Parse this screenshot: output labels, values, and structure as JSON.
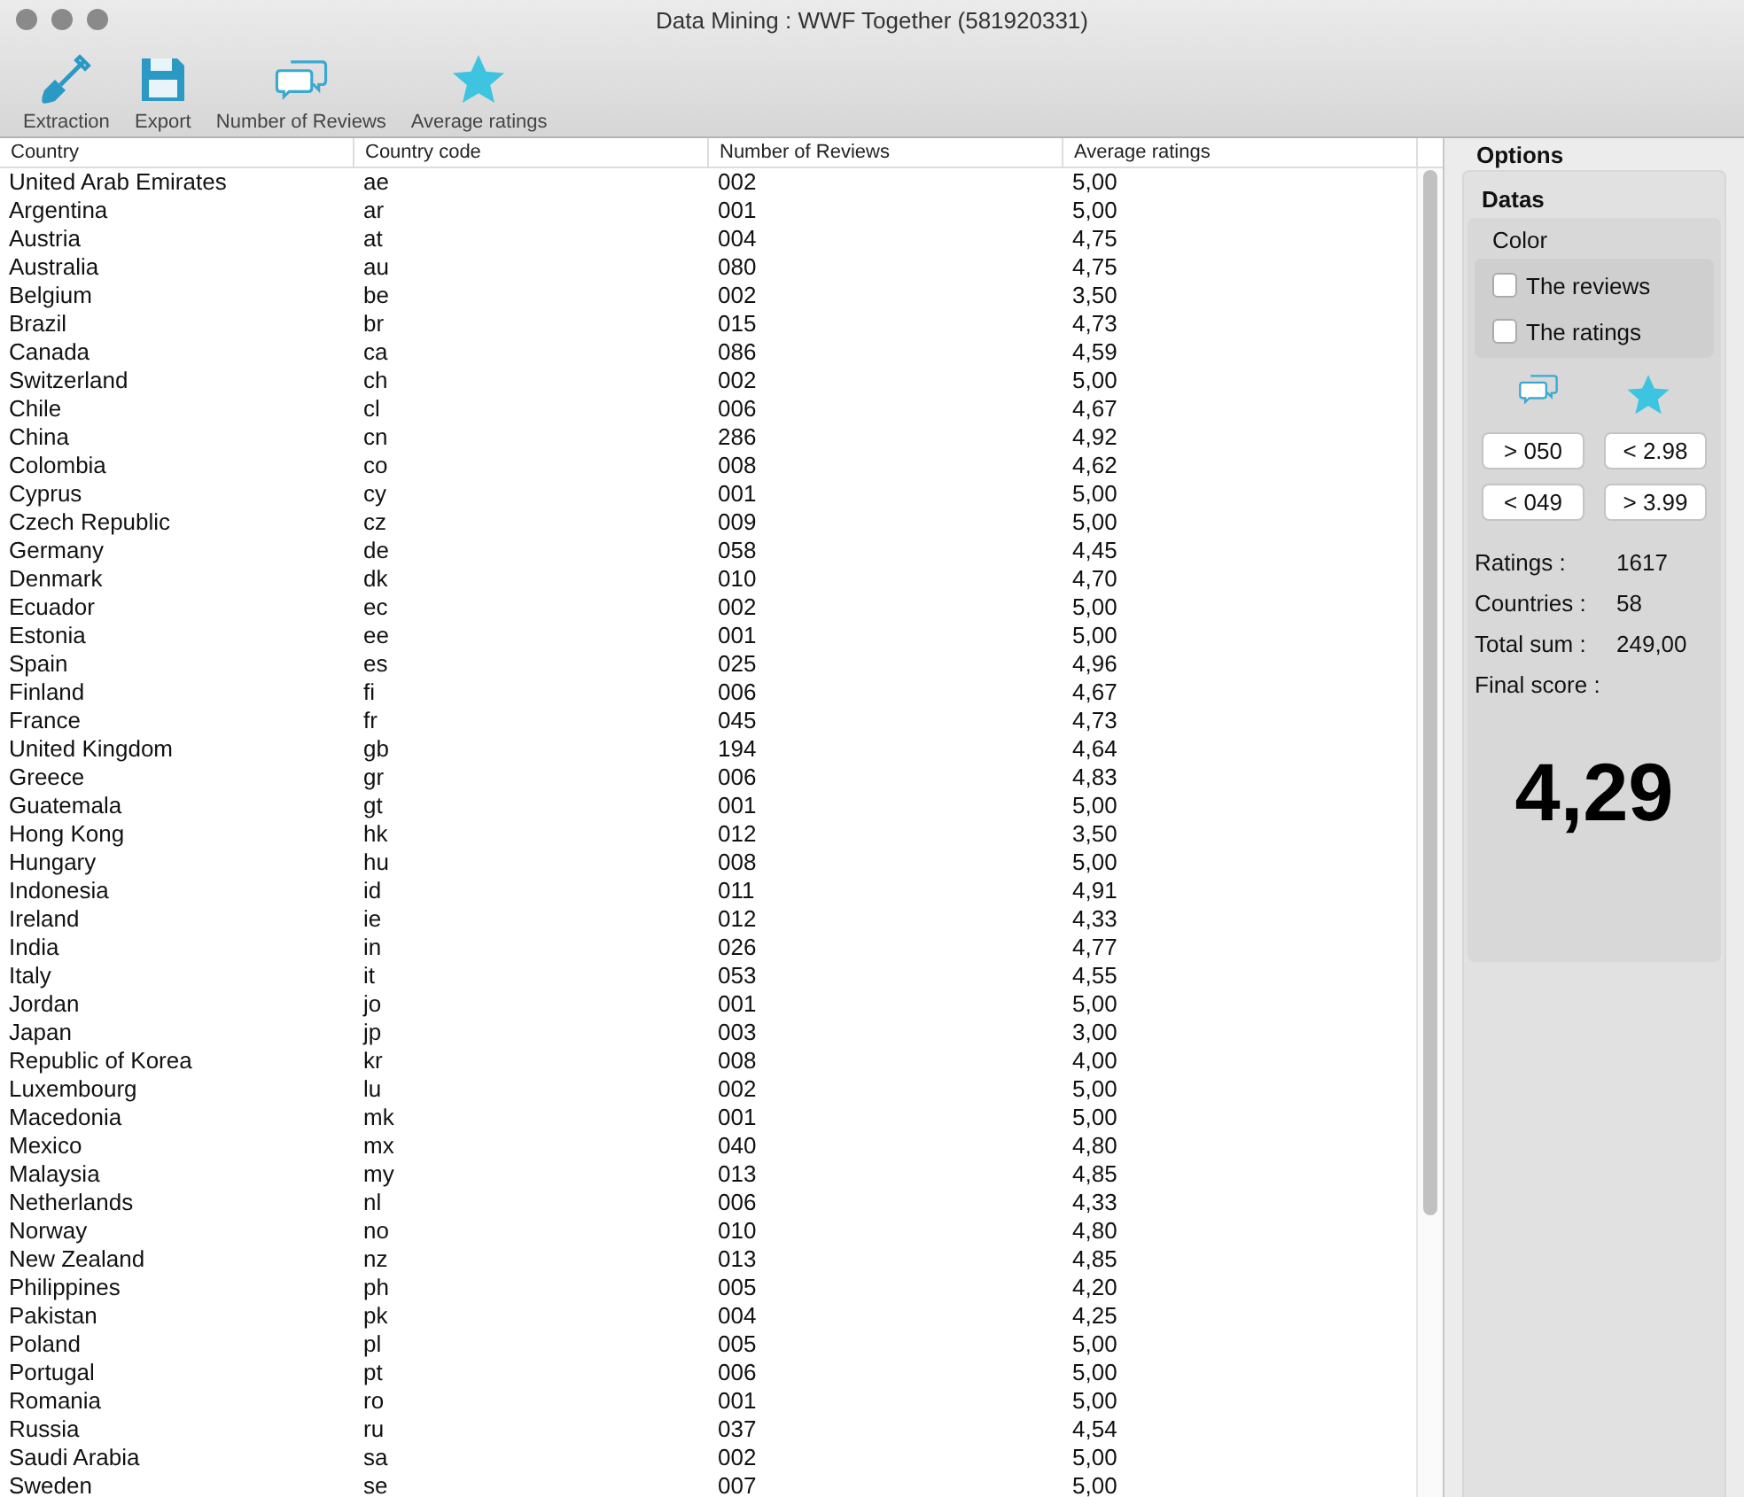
{
  "window": {
    "title": "Data Mining : WWF Together (581920331)"
  },
  "toolbar": [
    {
      "kind": "shovel",
      "label": "Extraction"
    },
    {
      "kind": "floppy",
      "label": "Export"
    },
    {
      "kind": "bubbles",
      "label": "Number of Reviews"
    },
    {
      "kind": "star",
      "label": "Average ratings"
    }
  ],
  "table": {
    "columns": [
      "Country",
      "Country code",
      "Number of Reviews",
      "Average ratings"
    ],
    "rows": [
      [
        "United Arab Emirates",
        "ae",
        "002",
        "5,00"
      ],
      [
        "Argentina",
        "ar",
        "001",
        "5,00"
      ],
      [
        "Austria",
        "at",
        "004",
        "4,75"
      ],
      [
        "Australia",
        "au",
        "080",
        "4,75"
      ],
      [
        "Belgium",
        "be",
        "002",
        "3,50"
      ],
      [
        "Brazil",
        "br",
        "015",
        "4,73"
      ],
      [
        "Canada",
        "ca",
        "086",
        "4,59"
      ],
      [
        "Switzerland",
        "ch",
        "002",
        "5,00"
      ],
      [
        "Chile",
        "cl",
        "006",
        "4,67"
      ],
      [
        "China",
        "cn",
        "286",
        "4,92"
      ],
      [
        "Colombia",
        "co",
        "008",
        "4,62"
      ],
      [
        "Cyprus",
        "cy",
        "001",
        "5,00"
      ],
      [
        "Czech Republic",
        "cz",
        "009",
        "5,00"
      ],
      [
        "Germany",
        "de",
        "058",
        "4,45"
      ],
      [
        "Denmark",
        "dk",
        "010",
        "4,70"
      ],
      [
        "Ecuador",
        "ec",
        "002",
        "5,00"
      ],
      [
        "Estonia",
        "ee",
        "001",
        "5,00"
      ],
      [
        "Spain",
        "es",
        "025",
        "4,96"
      ],
      [
        "Finland",
        "fi",
        "006",
        "4,67"
      ],
      [
        "France",
        "fr",
        "045",
        "4,73"
      ],
      [
        "United Kingdom",
        "gb",
        "194",
        "4,64"
      ],
      [
        "Greece",
        "gr",
        "006",
        "4,83"
      ],
      [
        "Guatemala",
        "gt",
        "001",
        "5,00"
      ],
      [
        "Hong Kong",
        "hk",
        "012",
        "3,50"
      ],
      [
        "Hungary",
        "hu",
        "008",
        "5,00"
      ],
      [
        "Indonesia",
        "id",
        "011",
        "4,91"
      ],
      [
        "Ireland",
        "ie",
        "012",
        "4,33"
      ],
      [
        "India",
        "in",
        "026",
        "4,77"
      ],
      [
        "Italy",
        "it",
        "053",
        "4,55"
      ],
      [
        "Jordan",
        "jo",
        "001",
        "5,00"
      ],
      [
        "Japan",
        "jp",
        "003",
        "3,00"
      ],
      [
        "Republic of Korea",
        "kr",
        "008",
        "4,00"
      ],
      [
        "Luxembourg",
        "lu",
        "002",
        "5,00"
      ],
      [
        "Macedonia",
        "mk",
        "001",
        "5,00"
      ],
      [
        "Mexico",
        "mx",
        "040",
        "4,80"
      ],
      [
        "Malaysia",
        "my",
        "013",
        "4,85"
      ],
      [
        "Netherlands",
        "nl",
        "006",
        "4,33"
      ],
      [
        "Norway",
        "no",
        "010",
        "4,80"
      ],
      [
        "New Zealand",
        "nz",
        "013",
        "4,85"
      ],
      [
        "Philippines",
        "ph",
        "005",
        "4,20"
      ],
      [
        "Pakistan",
        "pk",
        "004",
        "4,25"
      ],
      [
        "Poland",
        "pl",
        "005",
        "5,00"
      ],
      [
        "Portugal",
        "pt",
        "006",
        "5,00"
      ],
      [
        "Romania",
        "ro",
        "001",
        "5,00"
      ],
      [
        "Russia",
        "ru",
        "037",
        "4,54"
      ],
      [
        "Saudi Arabia",
        "sa",
        "002",
        "5,00"
      ],
      [
        "Sweden",
        "se",
        "007",
        "5,00"
      ]
    ]
  },
  "options": {
    "title": "Options",
    "section": "Datas",
    "color_title": "Color",
    "checkboxes": [
      {
        "label": "The reviews",
        "checked": false
      },
      {
        "label": "The ratings",
        "checked": false
      }
    ],
    "filter_icons": [
      {
        "kind": "bubbles"
      },
      {
        "kind": "star"
      }
    ],
    "filters": [
      [
        "> 050",
        "< 2.98"
      ],
      [
        "< 049",
        "> 3.99"
      ]
    ],
    "stats": [
      {
        "label": "Ratings :",
        "value": "1617"
      },
      {
        "label": "Countries :",
        "value": "58"
      },
      {
        "label": "Total sum :",
        "value": "249,00"
      }
    ],
    "final_label": "Final score :",
    "final_score": "4,29"
  }
}
